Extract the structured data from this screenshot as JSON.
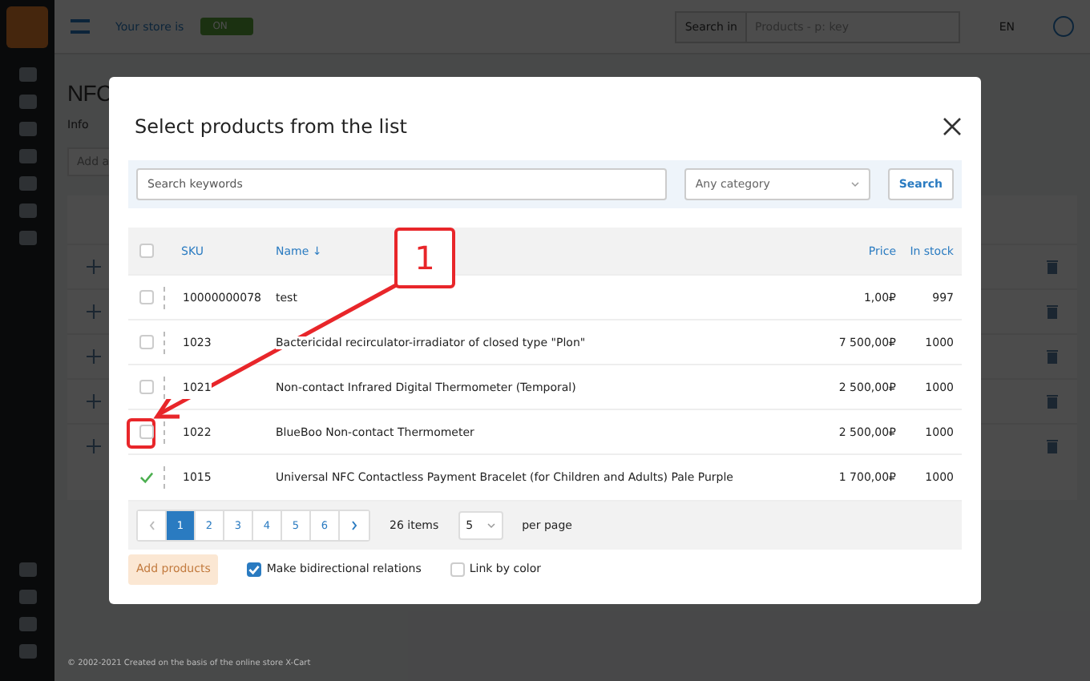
{
  "topbar": {
    "store_label": "Your store is",
    "store_toggle": {
      "label": "ON",
      "on": true
    },
    "search_scope": "Search in",
    "search_placeholder": "Products - p: key",
    "language": "EN"
  },
  "page": {
    "title": "NFC",
    "tab": "Info",
    "add_field": "Add a",
    "footer": "© 2002-2021 Created on the basis of the online store X-Cart"
  },
  "dialog": {
    "title": "Select products from the list",
    "search_placeholder": "Search keywords",
    "category": "Any category",
    "search_button": "Search",
    "columns": {
      "sku": "SKU",
      "name": "Name ↓",
      "price": "Price",
      "stock": "In stock"
    },
    "header_checked": false,
    "rows": [
      {
        "sku": "10000000078",
        "name": "test",
        "price": "1,00₽",
        "stock": "997",
        "selected": false
      },
      {
        "sku": "1023",
        "name": "Bactericidal recirculator-irradiator of closed type \"Plon\"",
        "price": "7 500,00₽",
        "stock": "1000",
        "selected": false
      },
      {
        "sku": "1021",
        "name": "Non-contact Infrared Digital Thermometer (Temporal)",
        "price": "2 500,00₽",
        "stock": "1000",
        "selected": false
      },
      {
        "sku": "1022",
        "name": "BlueBoo Non-contact Thermometer",
        "price": "2 500,00₽",
        "stock": "1000",
        "selected": false
      },
      {
        "sku": "1015",
        "name": "Universal NFC Contactless Payment Bracelet (for Children and Adults) Pale Purple",
        "price": "1 700,00₽",
        "stock": "1000",
        "selected": true
      }
    ],
    "pages": [
      {
        "label": "1",
        "selected": true
      },
      {
        "label": "2",
        "selected": false
      },
      {
        "label": "3",
        "selected": false
      },
      {
        "label": "4",
        "selected": false
      },
      {
        "label": "5",
        "selected": false
      },
      {
        "label": "6",
        "selected": false
      }
    ],
    "items_count": "26 items",
    "per_page_value": "5",
    "per_page_label": "per page",
    "add_button": {
      "label": "Add products",
      "disabled": true
    },
    "options": [
      {
        "label": "Make bidirectional relations",
        "checked": true
      },
      {
        "label": "Link by color",
        "checked": false
      }
    ]
  },
  "annotation": {
    "label": "1"
  }
}
